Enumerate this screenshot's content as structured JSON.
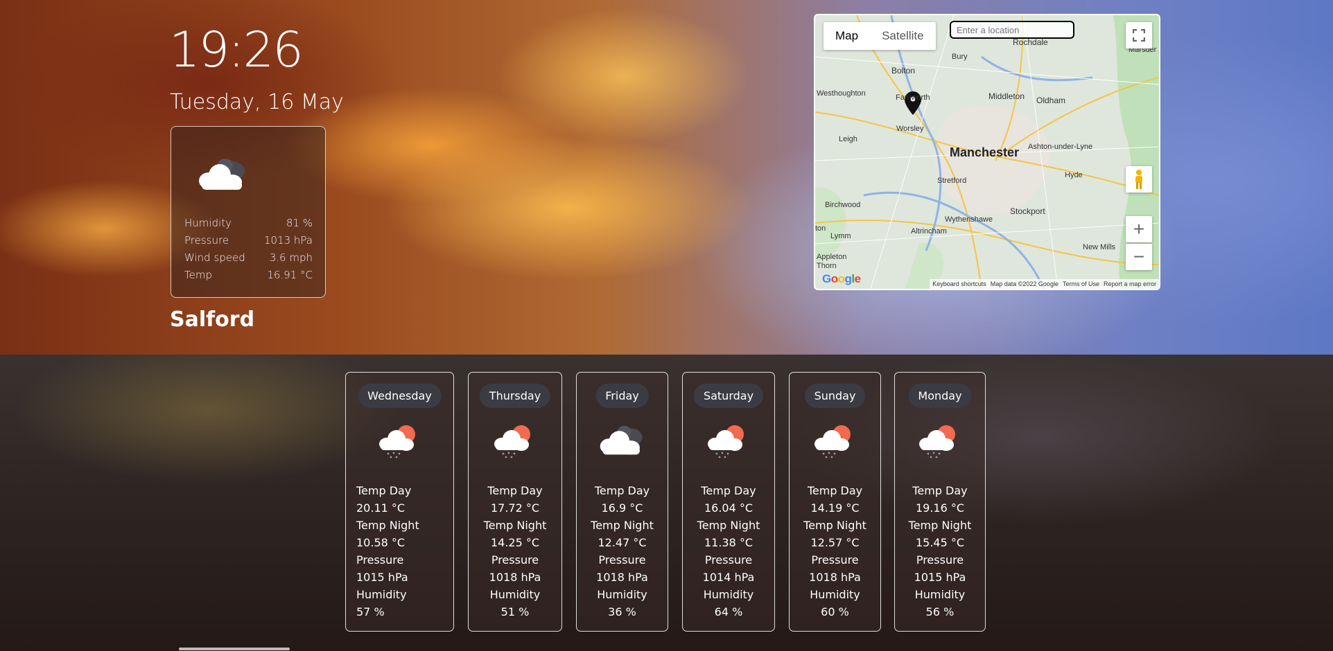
{
  "clock": "19:26",
  "date": "Tuesday, 16 May",
  "current": {
    "icon": "cloud-icon",
    "rows": [
      {
        "label": "Humidity",
        "value": "81 %"
      },
      {
        "label": "Pressure",
        "value": "1013 hPa"
      },
      {
        "label": "Wind speed",
        "value": "3.6 mph"
      },
      {
        "label": "Temp",
        "value": "16.91 °C"
      }
    ]
  },
  "city": "Salford",
  "map": {
    "tabs": [
      "Map",
      "Satellite"
    ],
    "search_placeholder": "Enter a location",
    "zoom_in": "+",
    "zoom_out": "−",
    "logo": "Google",
    "footer": [
      "Keyboard shortcuts",
      "Map data ©2022 Google",
      "Terms of Use",
      "Report a map error"
    ],
    "places": {
      "manchester": "Manchester",
      "bolton": "Bolton",
      "bury": "Bury",
      "rochdale": "Rochdale",
      "oldham": "Oldham",
      "middleton": "Middleton",
      "westhoughton": "Westhoughton",
      "farnworth": "Farnworth",
      "worsley": "Worsley",
      "leigh": "Leigh",
      "ashton": "Ashton-under-Lyne",
      "stretford": "Stretford",
      "hyde": "Hyde",
      "birchwood": "Birchwood",
      "wythenshawe": "Wythenshawe",
      "stockport": "Stockport",
      "lymm": "Lymm",
      "altrincham": "Altrincham",
      "appleton": "Appleton Thorn",
      "newmills": "New Mills",
      "marsden": "Marsder",
      "ton": "ton"
    }
  },
  "colors": {
    "accent": "#ffffff",
    "pill": "#3b3b44",
    "sun": "#f26a4f"
  },
  "forecast": [
    {
      "day": "Wednesday",
      "icon": "rain-sun-icon",
      "temp_day_label": "Temp Day",
      "temp_day": "20.11 °C",
      "temp_night_label": "Temp Night",
      "temp_night": "10.58 °C",
      "pressure_label": "Pressure",
      "pressure": "1015 hPa",
      "humidity_label": "Humidity",
      "humidity": "57 %"
    },
    {
      "day": "Thursday",
      "icon": "rain-sun-icon",
      "temp_day_label": "Temp Day",
      "temp_day": "17.72 °C",
      "temp_night_label": "Temp Night",
      "temp_night": "14.25 °C",
      "pressure_label": "Pressure",
      "pressure": "1018 hPa",
      "humidity_label": "Humidity",
      "humidity": "51 %"
    },
    {
      "day": "Friday",
      "icon": "cloud-icon",
      "temp_day_label": "Temp Day",
      "temp_day": "16.9 °C",
      "temp_night_label": "Temp Night",
      "temp_night": "12.47 °C",
      "pressure_label": "Pressure",
      "pressure": "1018 hPa",
      "humidity_label": "Humidity",
      "humidity": "36 %"
    },
    {
      "day": "Saturday",
      "icon": "rain-sun-icon",
      "temp_day_label": "Temp Day",
      "temp_day": "16.04 °C",
      "temp_night_label": "Temp Night",
      "temp_night": "11.38 °C",
      "pressure_label": "Pressure",
      "pressure": "1014 hPa",
      "humidity_label": "Humidity",
      "humidity": "64 %"
    },
    {
      "day": "Sunday",
      "icon": "rain-sun-icon",
      "temp_day_label": "Temp Day",
      "temp_day": "14.19 °C",
      "temp_night_label": "Temp Night",
      "temp_night": "12.57 °C",
      "pressure_label": "Pressure",
      "pressure": "1018 hPa",
      "humidity_label": "Humidity",
      "humidity": "60 %"
    },
    {
      "day": "Monday",
      "icon": "rain-sun-icon",
      "temp_day_label": "Temp Day",
      "temp_day": "19.16 °C",
      "temp_night_label": "Temp Night",
      "temp_night": "15.45 °C",
      "pressure_label": "Pressure",
      "pressure": "1015 hPa",
      "humidity_label": "Humidity",
      "humidity": "56 %"
    }
  ]
}
